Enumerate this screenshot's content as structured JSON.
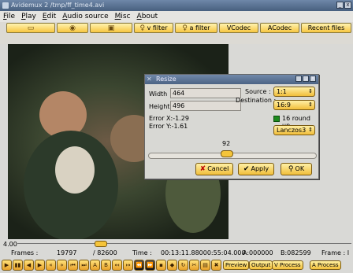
{
  "window": {
    "title": "Avidemux 2 /tmp/ff_time4.avi",
    "buttons": [
      "_",
      "□",
      "x"
    ]
  },
  "menu": [
    "File",
    "Play",
    "Edit",
    "Audio source",
    "Misc",
    "About"
  ],
  "toolbar": {
    "v_filter": "v filter",
    "a_filter": "a filter",
    "vcodec": "VCodec",
    "acodec": "ACodec",
    "recent": "Recent files"
  },
  "status": {
    "position": "4.00",
    "frames_label": "Frames :",
    "frame_current": "19797",
    "frame_total": "/ 82600",
    "time_label": "Time :",
    "time_value": "00:13:11.88000:55:04.000",
    "a_label": "A:000000",
    "b_label": "B:082599",
    "frame_type": "Frame : I",
    "slider_fraction": 0.24
  },
  "navigation": {
    "preview": "Preview",
    "output": "Output",
    "v_process": "V Process",
    "a_process": "A Process"
  },
  "dialog": {
    "title": "Resize",
    "width_label": "Width",
    "width_value": "464",
    "height_label": "Height",
    "height_value": "496",
    "source_label": "Source :",
    "source_value": "1:1",
    "destination_label": "Destination :",
    "destination_value": "16:9",
    "round_label": "16 round up",
    "error_x": "Error X:-1.29",
    "error_y": "Error Y:-1.61",
    "scale_value": "92",
    "algorithm": "Lanczos3",
    "cancel": "Cancel",
    "apply": "Apply",
    "ok": "OK"
  }
}
